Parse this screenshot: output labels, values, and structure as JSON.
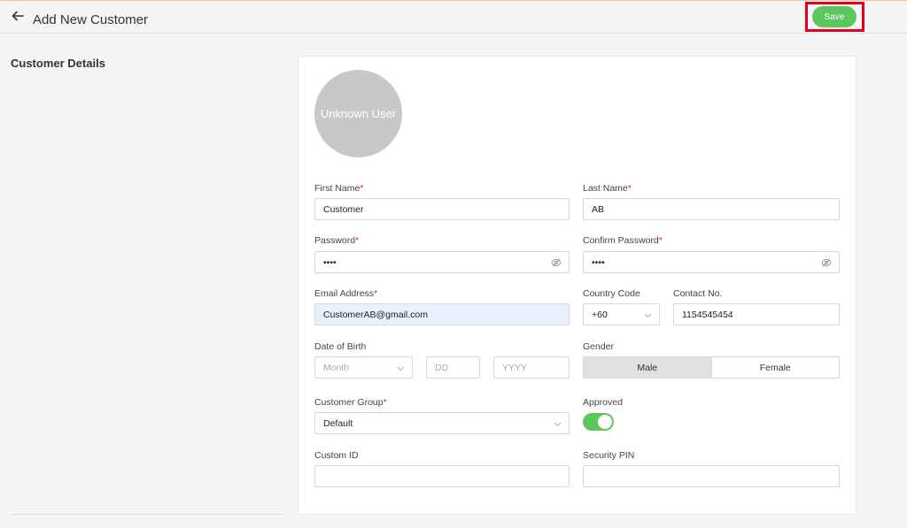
{
  "header": {
    "title": "Add New Customer",
    "save_label": "Save"
  },
  "section": {
    "title": "Customer Details"
  },
  "avatar": {
    "label": "Unknown User"
  },
  "form": {
    "first_name": {
      "label": "First Name",
      "value": "Customer"
    },
    "last_name": {
      "label": "Last Name",
      "value": "AB"
    },
    "password": {
      "label": "Password",
      "value": "••••"
    },
    "confirm_password": {
      "label": "Confirm Password",
      "value": "••••"
    },
    "email": {
      "label": "Email Address",
      "value": "CustomerAB@gmail.com"
    },
    "country_code": {
      "label": "Country Code",
      "value": "+60"
    },
    "contact_no": {
      "label": "Contact No.",
      "value": "1154545454"
    },
    "dob": {
      "label": "Date of Birth",
      "month": "Month",
      "day": "DD",
      "year": "YYYY"
    },
    "gender": {
      "label": "Gender",
      "options": [
        "Male",
        "Female"
      ],
      "selected": "Male"
    },
    "customer_group": {
      "label": "Customer Group",
      "value": "Default"
    },
    "approved": {
      "label": "Approved",
      "on": true
    },
    "custom_id": {
      "label": "Custom ID",
      "value": ""
    },
    "security_pin": {
      "label": "Security PIN",
      "value": ""
    }
  },
  "required_mark": "*",
  "colors": {
    "accent": "#5cc85c",
    "required": "#d32f2f",
    "highlight": "#e3001b"
  }
}
